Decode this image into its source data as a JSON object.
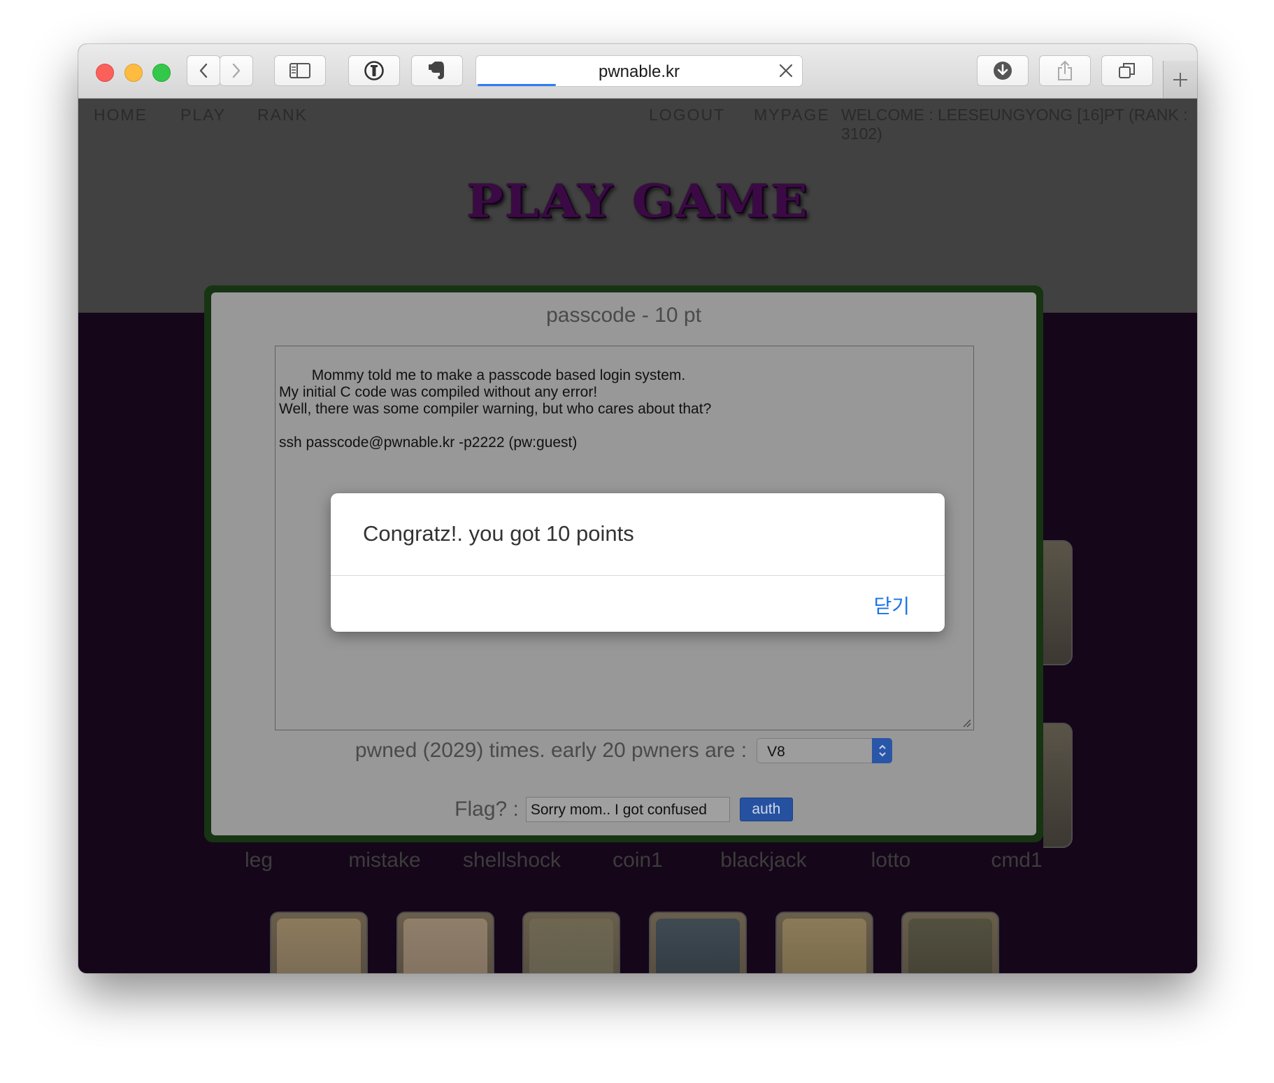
{
  "browser": {
    "url": "pwnable.kr",
    "icons": [
      "back-icon",
      "forward-icon",
      "sidebar-icon",
      "password-manager-icon",
      "evernote-icon",
      "downloads-icon",
      "share-icon",
      "tabs-icon",
      "new-tab-icon",
      "close-tab-icon"
    ]
  },
  "nav": {
    "home": "HOME",
    "play": "PLAY",
    "rank": "RANK",
    "logout": "LOGOUT",
    "mypage": "MYPAGE",
    "welcome": "WELCOME : LEESEUNGYONG [16]PT (RANK : 3102)"
  },
  "page": {
    "title": "PLAY GAME",
    "challenges": [
      "leg",
      "mistake",
      "shellshock",
      "coin1",
      "blackjack",
      "lotto",
      "cmd1"
    ]
  },
  "modal": {
    "title": "passcode - 10 pt",
    "description": "Mommy told me to make a passcode based login system.\nMy initial C code was compiled without any error!\nWell, there was some compiler warning, but who cares about that?\n\nssh passcode@pwnable.kr -p2222 (pw:guest)",
    "pwned_text": "pwned (2029) times. early 20 pwners are :",
    "pwner_selected": "V8",
    "flag_label": "Flag? :",
    "flag_value": "Sorry mom.. I got confused",
    "auth_label": "auth"
  },
  "alert": {
    "message": "Congratz!. you got 10 points",
    "close_label": "닫기"
  },
  "colors": {
    "accent": "#2e7cf6",
    "alert_link": "#1a73e8",
    "modal_border": "#173413",
    "title_purple": "#3b0a45"
  }
}
